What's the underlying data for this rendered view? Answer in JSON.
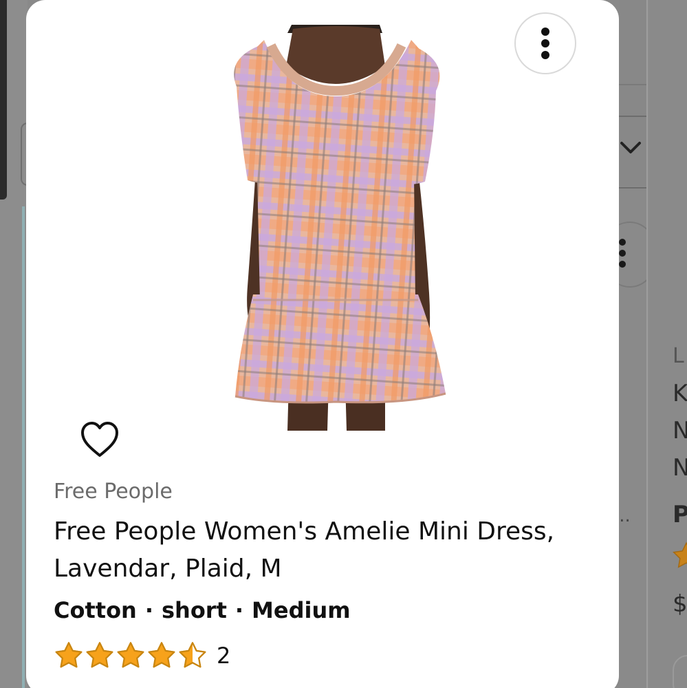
{
  "product": {
    "brand": "Free People",
    "title": "Free People Women's Amelie Mini Dress, Lavendar, Plaid, M",
    "attributes": [
      "Cotton",
      "short",
      "Medium"
    ],
    "separator": "·",
    "rating": {
      "stars": 4.5,
      "max_stars": 5,
      "review_count": "2"
    },
    "image_icon": "plaid-mini-dress-photo"
  },
  "actions": {
    "more_icon": "kebab-menu-icon",
    "favorite_icon": "heart-outline-icon"
  },
  "neighbor": {
    "lines": [
      "L",
      "K",
      "N",
      "N",
      "P",
      "$"
    ],
    "ellipsis": "..."
  },
  "colors": {
    "star_fill": "#f7a21b",
    "star_stroke": "#c98611",
    "text_primary": "#111111",
    "text_secondary": "#6b6b6b",
    "dim_overlay": "#898989"
  }
}
